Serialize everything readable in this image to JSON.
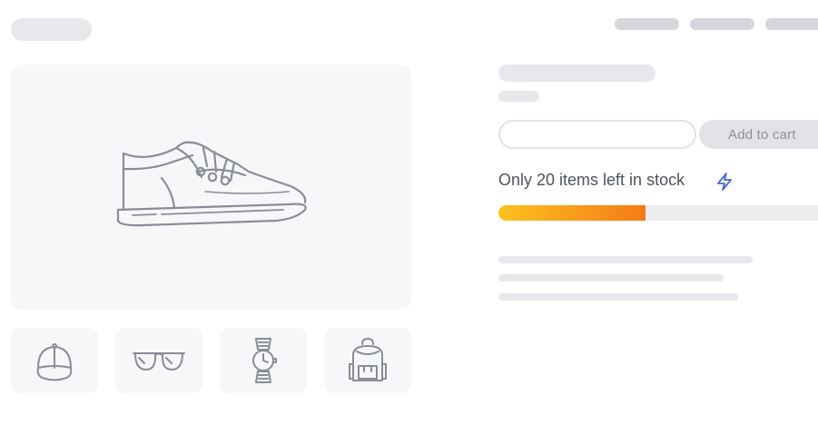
{
  "header": {
    "logo_placeholder": "logo-skeleton",
    "nav_items": [
      "nav-skeleton-1",
      "nav-skeleton-2",
      "nav-skeleton-3"
    ]
  },
  "gallery": {
    "main_image_icon": "sneaker-icon",
    "thumbnails": [
      {
        "icon": "cap-icon"
      },
      {
        "icon": "sunglasses-icon"
      },
      {
        "icon": "wristwatch-icon"
      },
      {
        "icon": "backpack-icon"
      }
    ]
  },
  "product": {
    "quantity": {
      "value": "",
      "placeholder": ""
    },
    "add_to_cart_label": "Add to cart",
    "stock": {
      "message": "Only 20 items left in stock",
      "icon": "lightning-bolt-icon",
      "level_fraction": 0.45
    }
  },
  "colors": {
    "skeleton": "#e7e8ec",
    "nav_skeleton": "#d5d6db",
    "panel_bg": "#f6f7f9",
    "line_art": "#8a8c98",
    "progress_start": "#fac21e",
    "progress_end": "#f57b14",
    "bolt": "#4a66d6",
    "button_bg": "#e2e3e7",
    "button_text": "#8d909a"
  }
}
